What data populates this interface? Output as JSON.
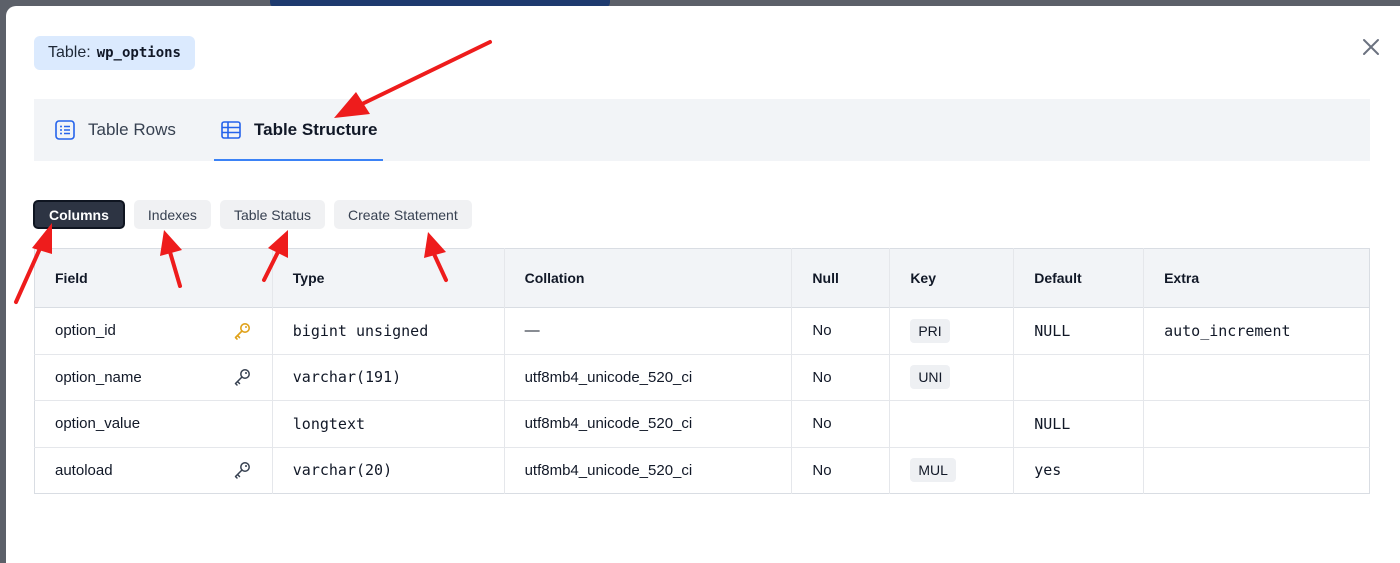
{
  "modal": {
    "table_label": "Table:",
    "table_name": "wp_options",
    "close_icon": "close-icon"
  },
  "tabs": [
    {
      "label": "Table Rows",
      "icon": "list-icon",
      "active": false
    },
    {
      "label": "Table Structure",
      "icon": "table-grid-icon",
      "active": true
    }
  ],
  "subtabs": [
    {
      "label": "Columns",
      "active": true
    },
    {
      "label": "Indexes",
      "active": false
    },
    {
      "label": "Table Status",
      "active": false
    },
    {
      "label": "Create Statement",
      "active": false
    }
  ],
  "table": {
    "headers": [
      "Field",
      "Type",
      "Collation",
      "Null",
      "Key",
      "Default",
      "Extra"
    ],
    "rows": [
      {
        "field": "option_id",
        "key_icon": "primary-key-icon",
        "type": "bigint unsigned",
        "collation": "—",
        "null": "No",
        "key": "PRI",
        "default": "NULL",
        "extra": "auto_increment"
      },
      {
        "field": "option_name",
        "key_icon": "key-icon",
        "type": "varchar(191)",
        "collation": "utf8mb4_unicode_520_ci",
        "null": "No",
        "key": "UNI",
        "default": "",
        "extra": ""
      },
      {
        "field": "option_value",
        "key_icon": "",
        "type": "longtext",
        "collation": "utf8mb4_unicode_520_ci",
        "null": "No",
        "key": "",
        "default": "NULL",
        "extra": ""
      },
      {
        "field": "autoload",
        "key_icon": "key-icon",
        "type": "varchar(20)",
        "collation": "utf8mb4_unicode_520_ci",
        "null": "No",
        "key": "MUL",
        "default": "yes",
        "extra": ""
      }
    ]
  },
  "colors": {
    "accent": "#3b82f6",
    "badge_bg": "#dbeafe",
    "active_subtab": "#2d3443",
    "primary_key": "#e0a21b",
    "annotation_arrow": "#ee1c1c"
  }
}
